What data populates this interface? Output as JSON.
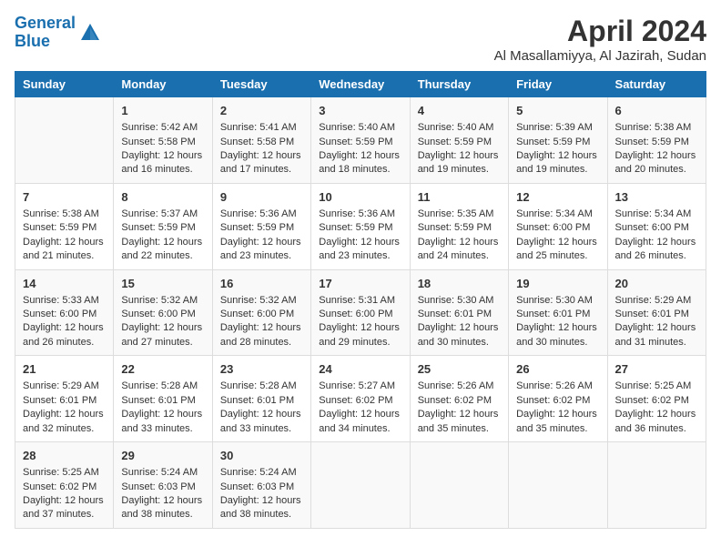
{
  "header": {
    "logo_line1": "General",
    "logo_line2": "Blue",
    "title": "April 2024",
    "subtitle": "Al Masallamiyya, Al Jazirah, Sudan"
  },
  "days_of_week": [
    "Sunday",
    "Monday",
    "Tuesday",
    "Wednesday",
    "Thursday",
    "Friday",
    "Saturday"
  ],
  "weeks": [
    [
      {
        "day": "",
        "lines": []
      },
      {
        "day": "1",
        "lines": [
          "Sunrise: 5:42 AM",
          "Sunset: 5:58 PM",
          "Daylight: 12 hours",
          "and 16 minutes."
        ]
      },
      {
        "day": "2",
        "lines": [
          "Sunrise: 5:41 AM",
          "Sunset: 5:58 PM",
          "Daylight: 12 hours",
          "and 17 minutes."
        ]
      },
      {
        "day": "3",
        "lines": [
          "Sunrise: 5:40 AM",
          "Sunset: 5:59 PM",
          "Daylight: 12 hours",
          "and 18 minutes."
        ]
      },
      {
        "day": "4",
        "lines": [
          "Sunrise: 5:40 AM",
          "Sunset: 5:59 PM",
          "Daylight: 12 hours",
          "and 19 minutes."
        ]
      },
      {
        "day": "5",
        "lines": [
          "Sunrise: 5:39 AM",
          "Sunset: 5:59 PM",
          "Daylight: 12 hours",
          "and 19 minutes."
        ]
      },
      {
        "day": "6",
        "lines": [
          "Sunrise: 5:38 AM",
          "Sunset: 5:59 PM",
          "Daylight: 12 hours",
          "and 20 minutes."
        ]
      }
    ],
    [
      {
        "day": "7",
        "lines": [
          "Sunrise: 5:38 AM",
          "Sunset: 5:59 PM",
          "Daylight: 12 hours",
          "and 21 minutes."
        ]
      },
      {
        "day": "8",
        "lines": [
          "Sunrise: 5:37 AM",
          "Sunset: 5:59 PM",
          "Daylight: 12 hours",
          "and 22 minutes."
        ]
      },
      {
        "day": "9",
        "lines": [
          "Sunrise: 5:36 AM",
          "Sunset: 5:59 PM",
          "Daylight: 12 hours",
          "and 23 minutes."
        ]
      },
      {
        "day": "10",
        "lines": [
          "Sunrise: 5:36 AM",
          "Sunset: 5:59 PM",
          "Daylight: 12 hours",
          "and 23 minutes."
        ]
      },
      {
        "day": "11",
        "lines": [
          "Sunrise: 5:35 AM",
          "Sunset: 5:59 PM",
          "Daylight: 12 hours",
          "and 24 minutes."
        ]
      },
      {
        "day": "12",
        "lines": [
          "Sunrise: 5:34 AM",
          "Sunset: 6:00 PM",
          "Daylight: 12 hours",
          "and 25 minutes."
        ]
      },
      {
        "day": "13",
        "lines": [
          "Sunrise: 5:34 AM",
          "Sunset: 6:00 PM",
          "Daylight: 12 hours",
          "and 26 minutes."
        ]
      }
    ],
    [
      {
        "day": "14",
        "lines": [
          "Sunrise: 5:33 AM",
          "Sunset: 6:00 PM",
          "Daylight: 12 hours",
          "and 26 minutes."
        ]
      },
      {
        "day": "15",
        "lines": [
          "Sunrise: 5:32 AM",
          "Sunset: 6:00 PM",
          "Daylight: 12 hours",
          "and 27 minutes."
        ]
      },
      {
        "day": "16",
        "lines": [
          "Sunrise: 5:32 AM",
          "Sunset: 6:00 PM",
          "Daylight: 12 hours",
          "and 28 minutes."
        ]
      },
      {
        "day": "17",
        "lines": [
          "Sunrise: 5:31 AM",
          "Sunset: 6:00 PM",
          "Daylight: 12 hours",
          "and 29 minutes."
        ]
      },
      {
        "day": "18",
        "lines": [
          "Sunrise: 5:30 AM",
          "Sunset: 6:01 PM",
          "Daylight: 12 hours",
          "and 30 minutes."
        ]
      },
      {
        "day": "19",
        "lines": [
          "Sunrise: 5:30 AM",
          "Sunset: 6:01 PM",
          "Daylight: 12 hours",
          "and 30 minutes."
        ]
      },
      {
        "day": "20",
        "lines": [
          "Sunrise: 5:29 AM",
          "Sunset: 6:01 PM",
          "Daylight: 12 hours",
          "and 31 minutes."
        ]
      }
    ],
    [
      {
        "day": "21",
        "lines": [
          "Sunrise: 5:29 AM",
          "Sunset: 6:01 PM",
          "Daylight: 12 hours",
          "and 32 minutes."
        ]
      },
      {
        "day": "22",
        "lines": [
          "Sunrise: 5:28 AM",
          "Sunset: 6:01 PM",
          "Daylight: 12 hours",
          "and 33 minutes."
        ]
      },
      {
        "day": "23",
        "lines": [
          "Sunrise: 5:28 AM",
          "Sunset: 6:01 PM",
          "Daylight: 12 hours",
          "and 33 minutes."
        ]
      },
      {
        "day": "24",
        "lines": [
          "Sunrise: 5:27 AM",
          "Sunset: 6:02 PM",
          "Daylight: 12 hours",
          "and 34 minutes."
        ]
      },
      {
        "day": "25",
        "lines": [
          "Sunrise: 5:26 AM",
          "Sunset: 6:02 PM",
          "Daylight: 12 hours",
          "and 35 minutes."
        ]
      },
      {
        "day": "26",
        "lines": [
          "Sunrise: 5:26 AM",
          "Sunset: 6:02 PM",
          "Daylight: 12 hours",
          "and 35 minutes."
        ]
      },
      {
        "day": "27",
        "lines": [
          "Sunrise: 5:25 AM",
          "Sunset: 6:02 PM",
          "Daylight: 12 hours",
          "and 36 minutes."
        ]
      }
    ],
    [
      {
        "day": "28",
        "lines": [
          "Sunrise: 5:25 AM",
          "Sunset: 6:02 PM",
          "Daylight: 12 hours",
          "and 37 minutes."
        ]
      },
      {
        "day": "29",
        "lines": [
          "Sunrise: 5:24 AM",
          "Sunset: 6:03 PM",
          "Daylight: 12 hours",
          "and 38 minutes."
        ]
      },
      {
        "day": "30",
        "lines": [
          "Sunrise: 5:24 AM",
          "Sunset: 6:03 PM",
          "Daylight: 12 hours",
          "and 38 minutes."
        ]
      },
      {
        "day": "",
        "lines": []
      },
      {
        "day": "",
        "lines": []
      },
      {
        "day": "",
        "lines": []
      },
      {
        "day": "",
        "lines": []
      }
    ]
  ]
}
